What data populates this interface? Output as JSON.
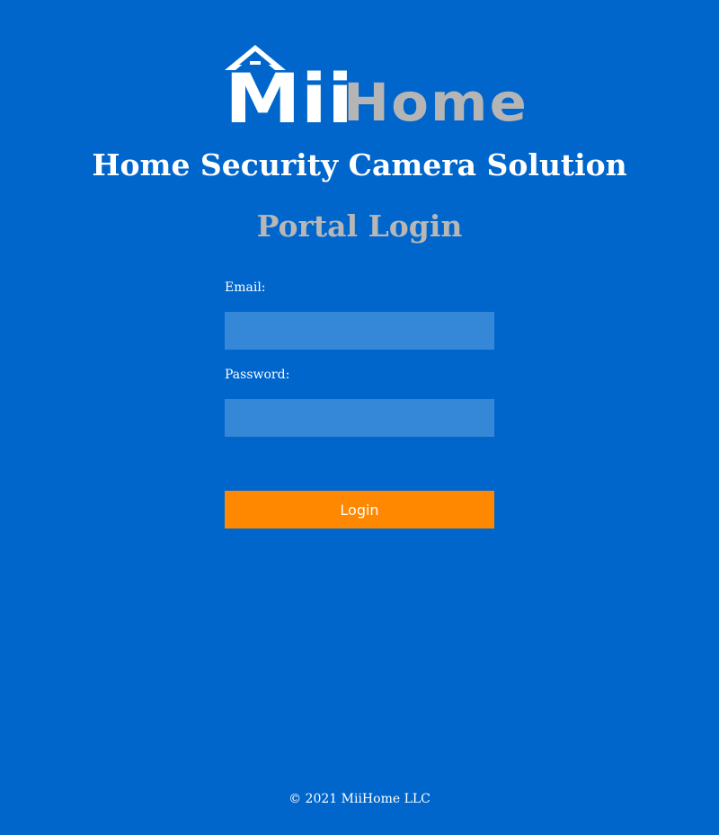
{
  "logo": {
    "mii_text": "Mii",
    "home_text": "Home",
    "house_icon": "house-roof-icon"
  },
  "header": {
    "tagline": "Home Security Camera Solution"
  },
  "login": {
    "title": "Portal Login",
    "email_label": "Email:",
    "email_value": "",
    "password_label": "Password:",
    "password_value": "",
    "button_label": "Login"
  },
  "footer": {
    "copyright": "© 2021 MiiHome LLC"
  },
  "colors": {
    "background": "#0066cc",
    "input_background": "#3587d8",
    "button": "#ff8800",
    "logo_home": "#b5b5b5",
    "portal_title": "#b7b7b7",
    "text": "#ffffff"
  }
}
